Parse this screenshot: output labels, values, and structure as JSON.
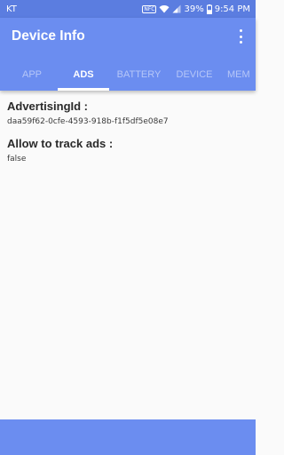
{
  "status_bar": {
    "carrier": "KT",
    "battery_percent": "39%",
    "time": "9:54 PM",
    "nfc_label": "NFC"
  },
  "app_bar": {
    "title": "Device Info"
  },
  "tabs": [
    {
      "label": "APP",
      "active": false
    },
    {
      "label": "ADS",
      "active": true
    },
    {
      "label": "BATTERY",
      "active": false
    },
    {
      "label": "DEVICE",
      "active": false
    },
    {
      "label": "MEM",
      "active": false
    }
  ],
  "fields": [
    {
      "label": "AdvertisingId :",
      "value": "daa59f62-0cfe-4593-918b-f1f5df5e08e7"
    },
    {
      "label": "Allow to track ads :",
      "value": "false"
    }
  ],
  "colors": {
    "status_bar": "#5b7de0",
    "primary": "#6b8df0",
    "background": "#fafafa"
  }
}
